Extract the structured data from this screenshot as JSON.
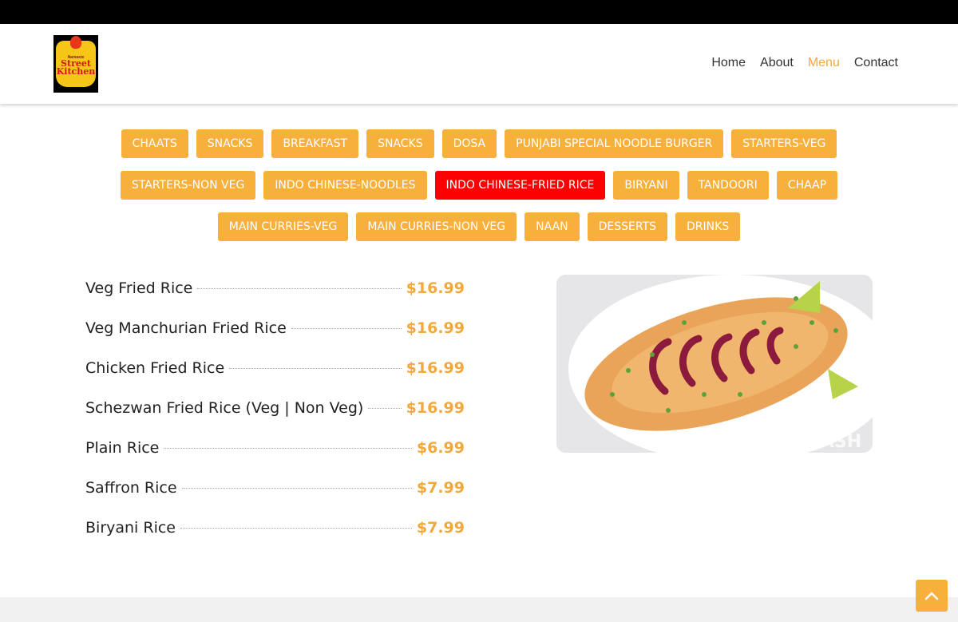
{
  "brand": {
    "logo_small": "Namaste",
    "logo_line1": "Street",
    "logo_line2": "Kitchen"
  },
  "nav": {
    "items": [
      "Home",
      "About",
      "Menu",
      "Contact"
    ],
    "active": "Menu"
  },
  "categories": {
    "row1": [
      "CHAATS",
      "SNACKS",
      "BREAKFAST",
      "SNACKS",
      "DOSA",
      "PUNJABI SPECIAL NOODLE BURGER",
      "STARTERS-VEG"
    ],
    "row2": [
      "STARTERS-NON VEG",
      "INDO CHINESE-NOODLES",
      "INDO CHINESE-FRIED RICE",
      "BIRYANI",
      "TANDOORI",
      "CHAAP"
    ],
    "row3": [
      "MAIN CURRIES-VEG",
      "MAIN CURRIES-NON VEG",
      "NAAN",
      "DESSERTS",
      "DRINKS"
    ],
    "selected": "INDO CHINESE-FRIED RICE"
  },
  "menu_items": [
    {
      "name": "Veg Fried Rice",
      "price": "$16.99"
    },
    {
      "name": "Veg Manchurian Fried Rice",
      "price": "$16.99"
    },
    {
      "name": "Chicken Fried Rice",
      "price": "$16.99"
    },
    {
      "name": "Schezwan Fried Rice (Veg | Non Veg)",
      "price": "$16.99"
    },
    {
      "name": "Plain Rice",
      "price": "$6.99"
    },
    {
      "name": "Saffron Rice",
      "price": "$7.99"
    },
    {
      "name": "Biryani Rice",
      "price": "$7.99"
    }
  ],
  "photo": {
    "watermark": "DOORDASH",
    "subject": "fried rice with red onion rings and lime wedges"
  },
  "colors": {
    "accent": "#f7b03c",
    "accent_text": "#f2a93b",
    "selected": "#ff0000",
    "topbar": "#000000"
  },
  "icons": {
    "back_to_top": "chevron-up-icon"
  }
}
